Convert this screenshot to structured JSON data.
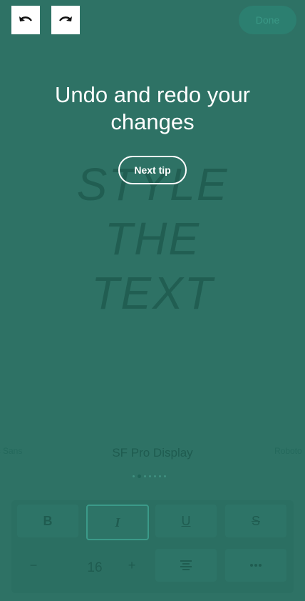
{
  "header": {
    "undo_icon": "undo-icon",
    "redo_icon": "redo-icon",
    "done_label": "Done"
  },
  "tip": {
    "title": "Undo and redo your changes",
    "next_label": "Next tip"
  },
  "preview": {
    "lines": [
      "STYLE",
      "THE",
      "TEXT"
    ]
  },
  "fonts": {
    "prev": "ic Sans",
    "current": "SF Pro Display",
    "next": "Roboto",
    "page_index": 2,
    "page_count": 7
  },
  "toolbar": {
    "bold_label": "B",
    "italic_label": "I",
    "underline_label": "U",
    "strike_label": "S",
    "minus_label": "−",
    "size_value": "16",
    "plus_label": "+",
    "align_icon": "align-center-icon",
    "more_icon": "more-dots-icon"
  },
  "colors": {
    "overlay": "#2e7265",
    "text_on_overlay": "#ffffff",
    "dimmed_text": "#1f5c50"
  }
}
